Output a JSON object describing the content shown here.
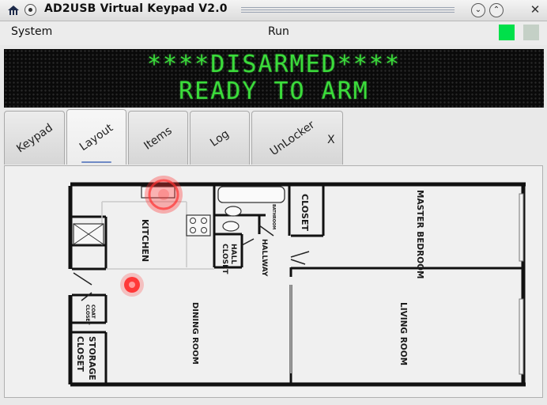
{
  "window": {
    "title": "AD2USB Virtual Keypad  V2.0",
    "min_glyph": "⌄",
    "max_glyph": "⌃",
    "close_glyph": "✕"
  },
  "menu": {
    "system_label": "System",
    "run_label": "Run"
  },
  "indicators": {
    "ready_color": "#00e04a",
    "armed_color": "#c4d0c6"
  },
  "display": {
    "line1": "****DISARMED****",
    "line2": "READY TO ARM",
    "text_color": "#3bdc3b"
  },
  "tabs": [
    {
      "label": "Keypad",
      "active": false
    },
    {
      "label": "Layout",
      "active": true
    },
    {
      "label": "Items",
      "active": false
    },
    {
      "label": "Log",
      "active": false
    },
    {
      "label": "UnLocker",
      "active": false,
      "close": "X"
    }
  ],
  "floorplan": {
    "rooms": {
      "kitchen": "KITCHEN",
      "closet": "CLOSET",
      "master_bedroom": "MASTER BEDROOM",
      "bathroom": "BATHROOM",
      "hall_closet_1": "HALL",
      "hall_closet_2": "CLOSET",
      "hallway": "HALLWAY",
      "coat_closet_1": "COAT",
      "coat_closet_2": "CLOSET",
      "dining_room": "DINING ROOM",
      "living_room": "LIVING ROOM",
      "storage_closet_1": "STORAGE",
      "storage_closet_2": "CLOSET"
    },
    "sensor_color": "#ff3030"
  }
}
